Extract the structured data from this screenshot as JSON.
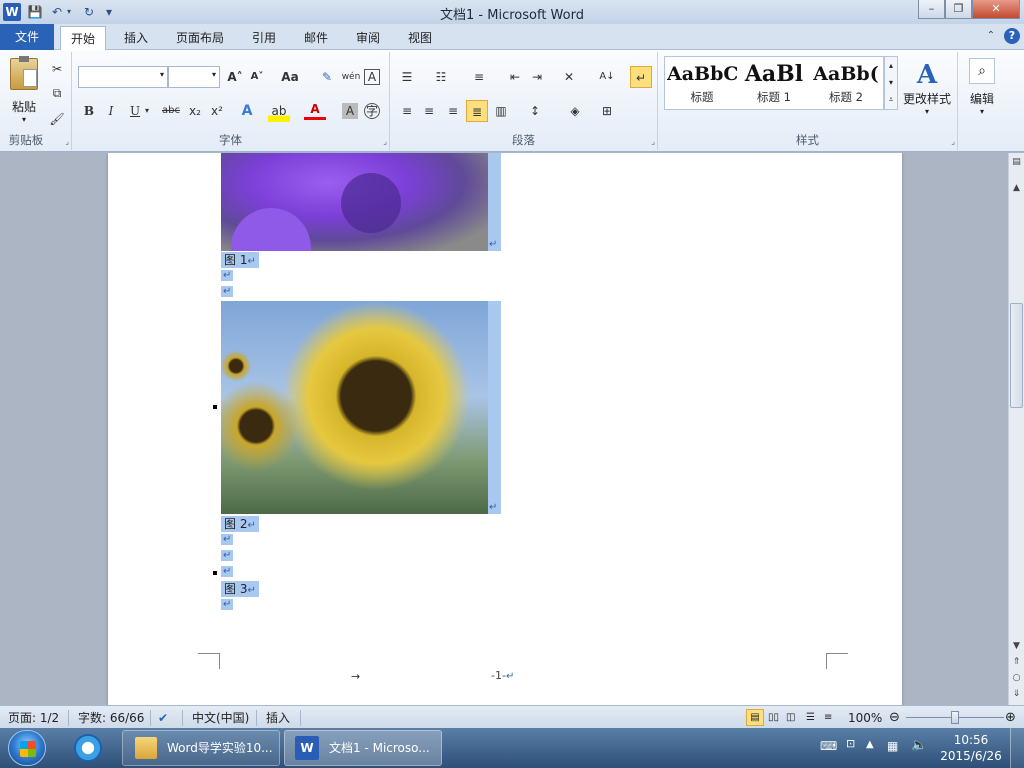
{
  "window": {
    "title": "文档1 - Microsoft Word",
    "app_icon": "W"
  },
  "quick_access": {
    "save_icon": "💾",
    "undo_icon": "↶",
    "redo_icon": "↻",
    "customize_icon": "▾"
  },
  "window_controls": {
    "minimize": "–",
    "maximize": "❐",
    "close": "✕"
  },
  "tabs": [
    {
      "label": "文件"
    },
    {
      "label": "开始"
    },
    {
      "label": "插入"
    },
    {
      "label": "页面布局"
    },
    {
      "label": "引用"
    },
    {
      "label": "邮件"
    },
    {
      "label": "审阅"
    },
    {
      "label": "视图"
    }
  ],
  "ribbon": {
    "clipboard": {
      "label": "剪贴板",
      "paste": "粘贴"
    },
    "font": {
      "label": "字体",
      "font_name": "",
      "font_size": "",
      "bold": "B",
      "italic": "I",
      "underline": "U",
      "strike": "abc",
      "subscript": "x₂",
      "superscript": "x²",
      "grow": "A˄",
      "shrink": "A˅",
      "change_case": "Aa",
      "font_color": "A"
    },
    "paragraph": {
      "label": "段落"
    },
    "styles": {
      "label": "样式",
      "items": [
        {
          "sample": "AaBbC",
          "name": "标题"
        },
        {
          "sample": "AaBl",
          "name": "标题 1"
        },
        {
          "sample": "AaBb(",
          "name": "标题 2"
        }
      ],
      "change_styles": "更改样式"
    },
    "editing": {
      "label": "编辑"
    }
  },
  "document": {
    "captions": [
      {
        "prefix": "图",
        "num": "1"
      },
      {
        "prefix": "图",
        "num": "2"
      },
      {
        "prefix": "图",
        "num": "3"
      }
    ],
    "pilcrow": "↵",
    "footer_page": "-1-",
    "footer_tab": "→"
  },
  "status": {
    "page": "页面: 1/2",
    "words": "字数: 66/66",
    "language": "中文(中国)",
    "mode": "插入",
    "zoom": "100%",
    "zoom_level": 0.5
  },
  "taskbar": {
    "items": [
      {
        "label": "Word导学实验10..."
      },
      {
        "label": "文档1 - Microso..."
      }
    ],
    "time": "10:56",
    "date": "2015/6/26"
  },
  "colors": {
    "accent": "#2a62b8",
    "selection": "#a9c8ef",
    "ribbon_bg": "#e4ecf7"
  }
}
